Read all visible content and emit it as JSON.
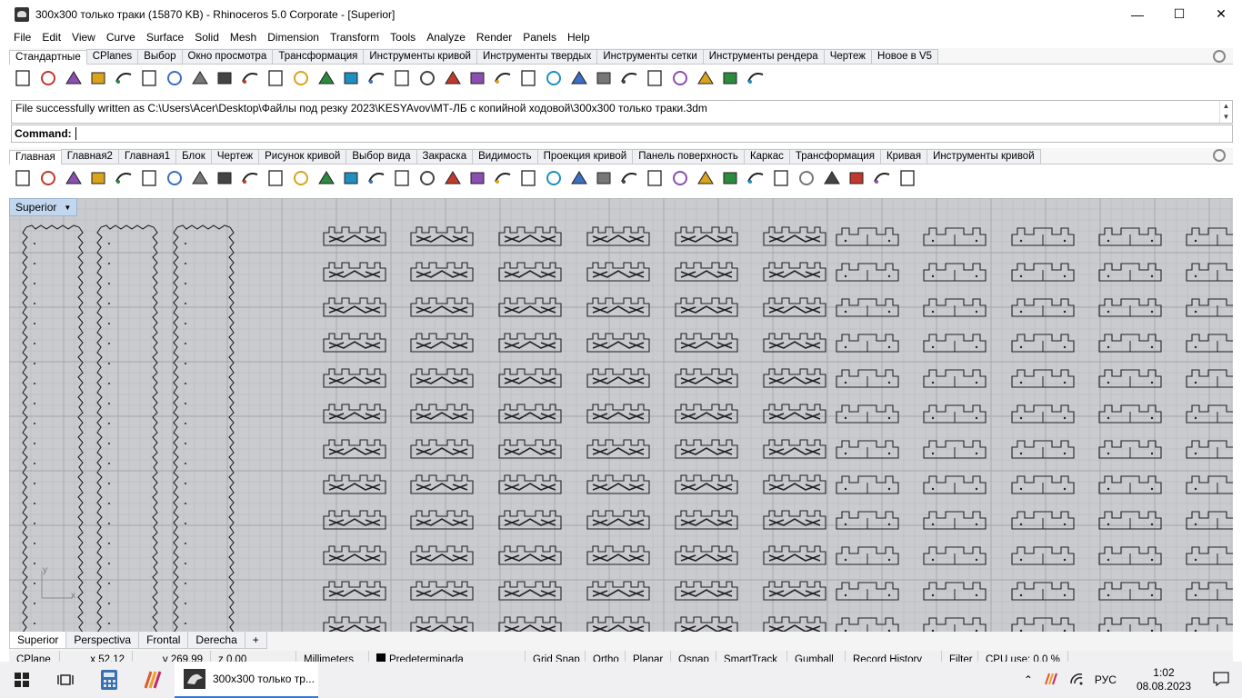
{
  "window": {
    "title": "300x300 только траки (15870 KB) - Rhinoceros  5.0 Corporate - [Superior]",
    "minimize": "—",
    "maximize": "☐",
    "close": "✕"
  },
  "menu": [
    "File",
    "Edit",
    "View",
    "Curve",
    "Surface",
    "Solid",
    "Mesh",
    "Dimension",
    "Transform",
    "Tools",
    "Analyze",
    "Render",
    "Panels",
    "Help"
  ],
  "toolbar_tabs_top": [
    "Стандартные",
    "CPlanes",
    "Выбор",
    "Окно просмотра",
    "Трансформация",
    "Инструменты кривой",
    "Инструменты твердых",
    "Инструменты сетки",
    "Инструменты рендера",
    "Чертеж",
    "Новое в V5"
  ],
  "toolbar_tabs_main": [
    "Главная",
    "Главная2",
    "Главная1",
    "Блок",
    "Чертеж",
    "Рисунок кривой",
    "Выбор вида",
    "Закраска",
    "Видимость",
    "Проекция кривой",
    "Панель поверхность",
    "Каркас",
    "Трансформация",
    "Кривая",
    "Инструменты кривой"
  ],
  "command": {
    "history": "File successfully written as C:\\Users\\Acer\\Desktop\\Файлы под резку 2023\\KESYAvov\\МТ-ЛБ с копийной ходовой\\300x300 только траки.3dm",
    "prompt": "Command:"
  },
  "viewport": {
    "name": "Superior",
    "axis_y": "y",
    "axis_x": "x"
  },
  "view_tabs": [
    "Superior",
    "Perspectiva",
    "Frontal",
    "Derecha",
    "+"
  ],
  "status": {
    "cplane": "CPlane",
    "x": "x 52.12",
    "y": "y 269.99",
    "z": "z 0.00",
    "units": "Millimeters",
    "layer": "Predeterminada",
    "toggles": [
      "Grid Snap",
      "Ortho",
      "Planar",
      "Osnap",
      "SmartTrack",
      "Gumball",
      "Record History",
      "Filter"
    ],
    "cpu": "CPU use: 0.0 %"
  },
  "taskbar": {
    "active_app": "300x300 только тр...",
    "lang": "РУС",
    "time": "1:02",
    "date": "08.08.2023"
  },
  "icons_top": [
    "new-icon",
    "open-icon",
    "save-icon",
    "print-icon",
    "import-icon",
    "cut-icon",
    "copy-icon",
    "paste-icon",
    "undo-icon",
    "pan-icon",
    "rotate-icon",
    "zoom-icon",
    "zoom-window-icon",
    "zoom-extents-icon",
    "zoom-selected-icon",
    "rotate-view-icon",
    "four-views-icon",
    "car-icon",
    "hide-icon",
    "lock-icon",
    "layer-icon",
    "select-color-icon",
    "properties-icon",
    "render-icon",
    "shaded-icon",
    "light-icon",
    "sphere-icon",
    "settings-icon",
    "toolbar-icon",
    "help-icon"
  ],
  "icons_main": [
    "select-icon",
    "point-icon",
    "polyline-icon",
    "curve-icon",
    "circle-icon",
    "ellipse-icon",
    "arc-icon",
    "rectangle-icon",
    "polygon-icon",
    "fillet-icon",
    "extrude-icon",
    "surface-icon",
    "box-icon",
    "sphere-icon",
    "cylinder-icon",
    "mesh-icon",
    "transform-icon",
    "dimension-icon",
    "move-icon",
    "copy-icon",
    "boolean-icon",
    "explode-icon",
    "join-icon",
    "offset-icon",
    "text-icon",
    "align-icon",
    "group-icon",
    "array-icon",
    "block-icon",
    "grid-icon",
    "array-grid-icon",
    "gumball-icon",
    "material-icon",
    "check-icon",
    "shade-icon",
    "paint-icon"
  ]
}
